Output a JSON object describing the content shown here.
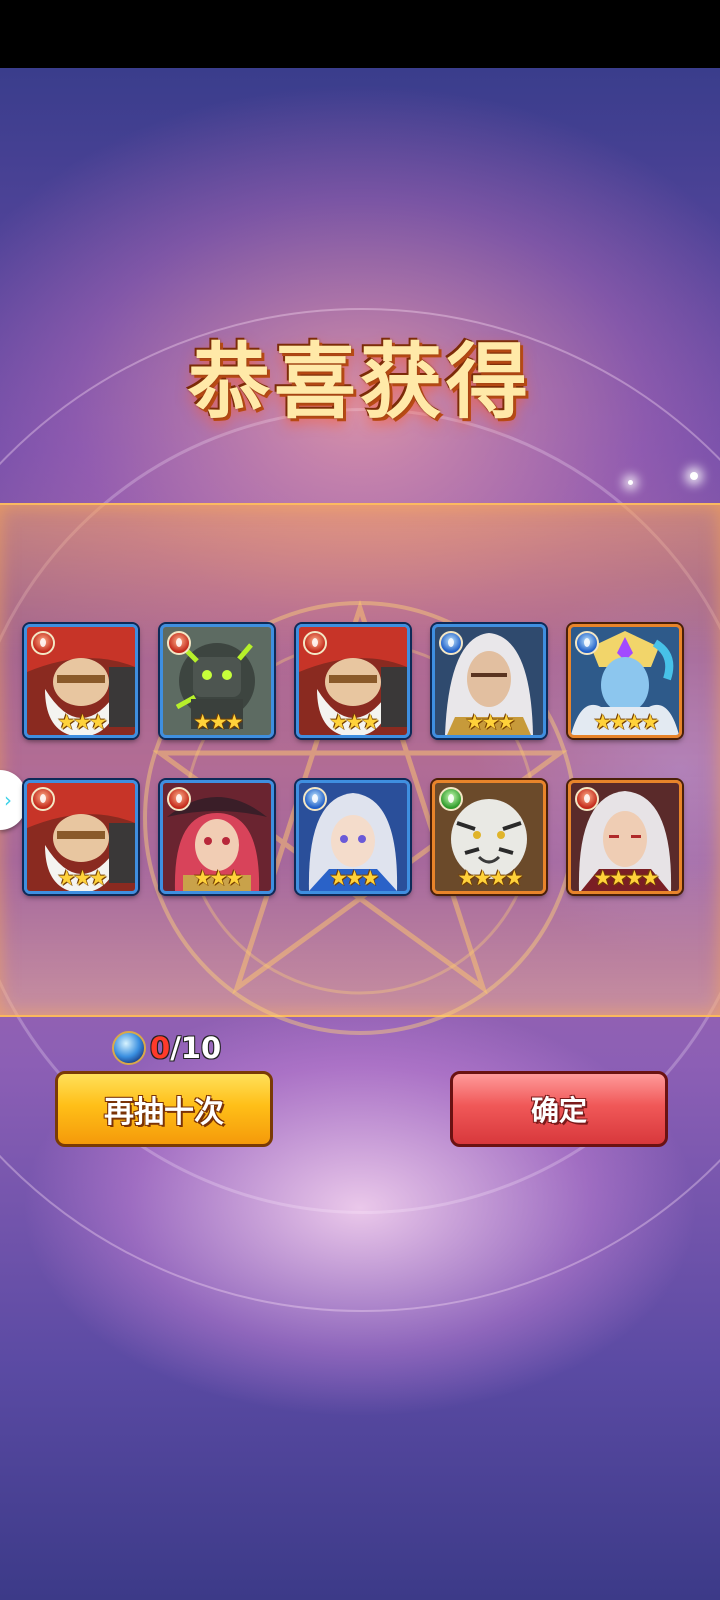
{
  "title": "恭喜获得",
  "heroes": [
    {
      "element": "fire",
      "stars": "★★★",
      "frame": "blue",
      "portrait": "bearded-dwarf"
    },
    {
      "element": "fire",
      "stars": "★★★",
      "frame": "blue",
      "portrait": "stone-golem"
    },
    {
      "element": "fire",
      "stars": "★★★",
      "frame": "blue",
      "portrait": "bearded-dwarf"
    },
    {
      "element": "water",
      "stars": "★★★",
      "frame": "blue",
      "portrait": "white-haired-elf"
    },
    {
      "element": "water",
      "stars": "★★★★",
      "frame": "gold",
      "portrait": "ice-warrior"
    },
    {
      "element": "fire",
      "stars": "★★★",
      "frame": "blue",
      "portrait": "bearded-dwarf"
    },
    {
      "element": "fire",
      "stars": "★★★",
      "frame": "blue",
      "portrait": "pirate-girl"
    },
    {
      "element": "water",
      "stars": "★★★",
      "frame": "blue",
      "portrait": "silver-haired-girl"
    },
    {
      "element": "wind",
      "stars": "★★★★",
      "frame": "gold",
      "portrait": "white-tiger"
    },
    {
      "element": "fire",
      "stars": "★★★★",
      "frame": "gold",
      "portrait": "silver-haired-lord"
    }
  ],
  "counter": {
    "current": "0",
    "total": "/10"
  },
  "buttons": {
    "retry": "再抽十次",
    "confirm": "确定"
  }
}
